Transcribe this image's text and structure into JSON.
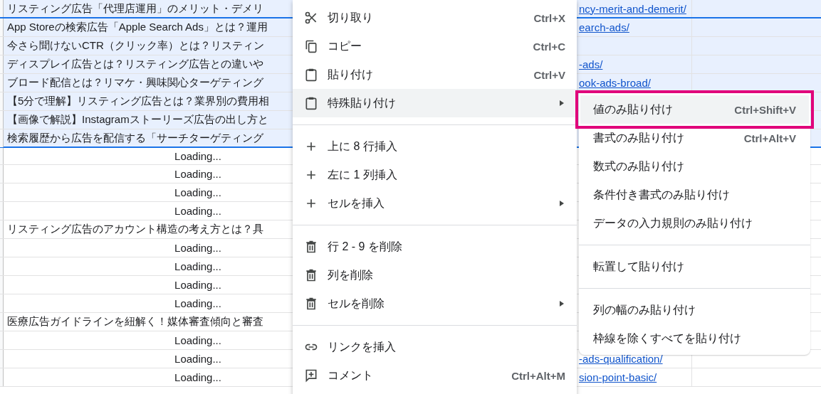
{
  "sheet": {
    "rows": [
      {
        "kind": "text",
        "title": "リスティング広告「代理店運用」のメリット・デメリ",
        "link": "ncy-merit-and-demerit/",
        "selected": true,
        "active": true
      },
      {
        "kind": "text",
        "title": "App Storeの検索広告「Apple Search Ads」とは？運用",
        "link": "earch-ads/",
        "selected": true,
        "active": false
      },
      {
        "kind": "text",
        "title": "今さら聞けないCTR（クリック率）とは？リスティン",
        "selected": true,
        "active": false
      },
      {
        "kind": "text",
        "title": "ディスプレイ広告とは？リスティング広告との違いや",
        "link": "-ads/",
        "selected": true,
        "active": false
      },
      {
        "kind": "text",
        "title": "ブロード配信とは？リマケ・興味関心ターゲティング",
        "link": "ook-ads-broad/",
        "selected": true,
        "active": false
      },
      {
        "kind": "text",
        "title": "【5分で理解】リスティング広告とは？業界別の費用相",
        "selected": true,
        "active": false
      },
      {
        "kind": "text",
        "title": "【画像で解説】Instagramストーリーズ広告の出し方と",
        "selected": true,
        "active": false
      },
      {
        "kind": "text",
        "title": "検索履歴から広告を配信する「サーチターゲティング",
        "selected": true,
        "active": false
      },
      {
        "kind": "loading",
        "title": "Loading...",
        "selected": false,
        "active": false
      },
      {
        "kind": "loading",
        "title": "Loading...",
        "selected": false,
        "active": false
      },
      {
        "kind": "loading",
        "title": "Loading...",
        "selected": false,
        "active": false
      },
      {
        "kind": "loading",
        "title": "Loading...",
        "selected": false,
        "active": false
      },
      {
        "kind": "text",
        "title": "リスティング広告のアカウント構造の考え方とは？具",
        "selected": false,
        "active": false
      },
      {
        "kind": "loading",
        "title": "Loading...",
        "selected": false,
        "active": false
      },
      {
        "kind": "loading",
        "title": "Loading...",
        "selected": false,
        "active": false
      },
      {
        "kind": "loading",
        "title": "Loading...",
        "selected": false,
        "active": false
      },
      {
        "kind": "loading",
        "title": "Loading...",
        "selected": false,
        "active": false
      },
      {
        "kind": "text",
        "title": "医療広告ガイドラインを紐解く！媒体審査傾向と審査",
        "selected": false,
        "active": false
      },
      {
        "kind": "loading",
        "title": "Loading...",
        "selected": false,
        "active": false
      },
      {
        "kind": "loading",
        "title": "Loading...",
        "link": "-ads-qualification/",
        "selected": false,
        "active": false
      },
      {
        "kind": "loading",
        "title": "Loading...",
        "link": "sion-point-basic/",
        "selected": false,
        "active": false
      }
    ]
  },
  "context_menu": {
    "items": [
      {
        "kind": "item",
        "label": "切り取り",
        "shortcut": "Ctrl+X",
        "submenu": false,
        "selected": false
      },
      {
        "kind": "item",
        "label": "コピー",
        "shortcut": "Ctrl+C",
        "submenu": false,
        "selected": false
      },
      {
        "kind": "item",
        "label": "貼り付け",
        "shortcut": "Ctrl+V",
        "submenu": false,
        "selected": false
      },
      {
        "kind": "item",
        "label": "特殊貼り付け",
        "submenu": true,
        "selected": true
      },
      {
        "kind": "separator"
      },
      {
        "kind": "item",
        "label": "上に 8 行挿入",
        "submenu": false,
        "selected": false
      },
      {
        "kind": "item",
        "label": "左に 1 列挿入",
        "submenu": false,
        "selected": false
      },
      {
        "kind": "item",
        "label": "セルを挿入",
        "submenu": true,
        "selected": false
      },
      {
        "kind": "separator"
      },
      {
        "kind": "item",
        "label": "行 2 - 9 を削除",
        "submenu": false,
        "selected": false
      },
      {
        "kind": "item",
        "label": "列を削除",
        "submenu": false,
        "selected": false
      },
      {
        "kind": "item",
        "label": "セルを削除",
        "submenu": true,
        "selected": false
      },
      {
        "kind": "separator"
      },
      {
        "kind": "item",
        "label": "リンクを挿入",
        "submenu": false,
        "selected": false
      },
      {
        "kind": "item",
        "label": "コメント",
        "shortcut": "Ctrl+Alt+M",
        "submenu": false,
        "selected": false
      }
    ]
  },
  "paste_special_menu": {
    "items": [
      {
        "kind": "item",
        "label": "値のみ貼り付け",
        "shortcut": "Ctrl+Shift+V",
        "highlighted": true
      },
      {
        "kind": "item",
        "label": "書式のみ貼り付け",
        "shortcut": "Ctrl+Alt+V",
        "highlighted": false
      },
      {
        "kind": "item",
        "label": "数式のみ貼り付け",
        "highlighted": false
      },
      {
        "kind": "item",
        "label": "条件付き書式のみ貼り付け",
        "highlighted": false
      },
      {
        "kind": "item",
        "label": "データの入力規則のみ貼り付け",
        "highlighted": false
      },
      {
        "kind": "separator"
      },
      {
        "kind": "item",
        "label": "転置して貼り付け",
        "highlighted": false
      },
      {
        "kind": "separator"
      },
      {
        "kind": "item",
        "label": "列の幅のみ貼り付け",
        "highlighted": false
      },
      {
        "kind": "item",
        "label": "枠線を除くすべてを貼り付け",
        "highlighted": false
      }
    ]
  }
}
